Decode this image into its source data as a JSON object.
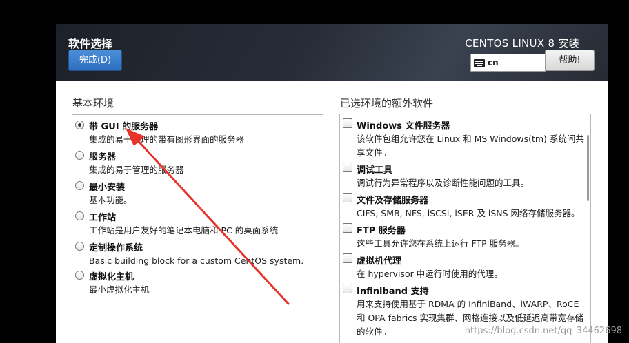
{
  "header": {
    "title": "软件选择",
    "done_label": "完成(D)",
    "product": "CENTOS LINUX 8 安装",
    "keyboard_layout": "cn",
    "help_label": "帮助!"
  },
  "left": {
    "label": "基本环境",
    "items": [
      {
        "title": "带 GUI 的服务器",
        "desc": "集成的易于管理的带有图形界面的服务器",
        "selected": true
      },
      {
        "title": "服务器",
        "desc": "集成的易于管理的服务器",
        "selected": false
      },
      {
        "title": "最小安装",
        "desc": "基本功能。",
        "selected": false
      },
      {
        "title": "工作站",
        "desc": "工作站是用户友好的笔记本电脑和 PC 的桌面系统",
        "selected": false
      },
      {
        "title": "定制操作系统",
        "desc": "Basic building block for a custom CentOS system.",
        "selected": false
      },
      {
        "title": "虚拟化主机",
        "desc": "最小虚拟化主机。",
        "selected": false
      }
    ]
  },
  "right": {
    "label": "已选环境的额外软件",
    "items": [
      {
        "title": "Windows 文件服务器",
        "desc_lines": [
          "该软件包组允许您在 Linux 和 MS Windows(tm) 系统间共",
          "享文件。"
        ],
        "checked": false
      },
      {
        "title": "调试工具",
        "desc_lines": [
          "调试行为异常程序以及诊断性能问题的工具。"
        ],
        "checked": false
      },
      {
        "title": "文件及存储服务器",
        "desc_lines": [
          "CIFS, SMB, NFS, iSCSI, iSER 及 iSNS 网络存储服务器。"
        ],
        "checked": false
      },
      {
        "title": "FTP 服务器",
        "desc_lines": [
          "这些工具允许您在系统上运行 FTP 服务器。"
        ],
        "checked": false
      },
      {
        "title": "虚拟机代理",
        "desc_lines": [
          "在 hypervisor 中运行时使用的代理。"
        ],
        "checked": false
      },
      {
        "title": "Infiniband 支持",
        "desc_lines": [
          "用来支持使用基于 RDMA 的 InfiniBand、iWARP、RoCE",
          "和 OPA fabrics 实现集群、网格连接以及低延迟高带宽存储",
          "的软件。"
        ],
        "checked": false
      }
    ]
  },
  "watermark": "https://blog.csdn.net/qq_34462698",
  "colors": {
    "accent": "#2e6fbf",
    "annotation": "#e8322b"
  }
}
